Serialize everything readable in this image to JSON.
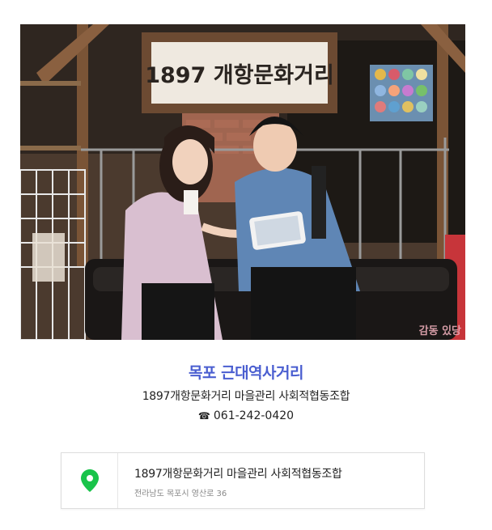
{
  "photo": {
    "alt": "두 사람이 1897 개항문화거리 간판 아래 소파에 앉아 태블릿을 보고 있는 사진",
    "sign_text": "1897 개항문화거리",
    "watermark": "감동 있당"
  },
  "place": {
    "title": "목포 근대역사거리",
    "organization": "1897개항문화거리 마을관리 사회적협동조합",
    "phone_icon": "☎",
    "phone": "061-242-0420"
  },
  "map_card": {
    "icon": "map-pin-icon",
    "name": "1897개항문화거리 마을관리 사회적협동조합",
    "address": "전라남도 목포시 영산로 36"
  },
  "colors": {
    "title": "#4a5ed0",
    "pin": "#19c34a"
  }
}
